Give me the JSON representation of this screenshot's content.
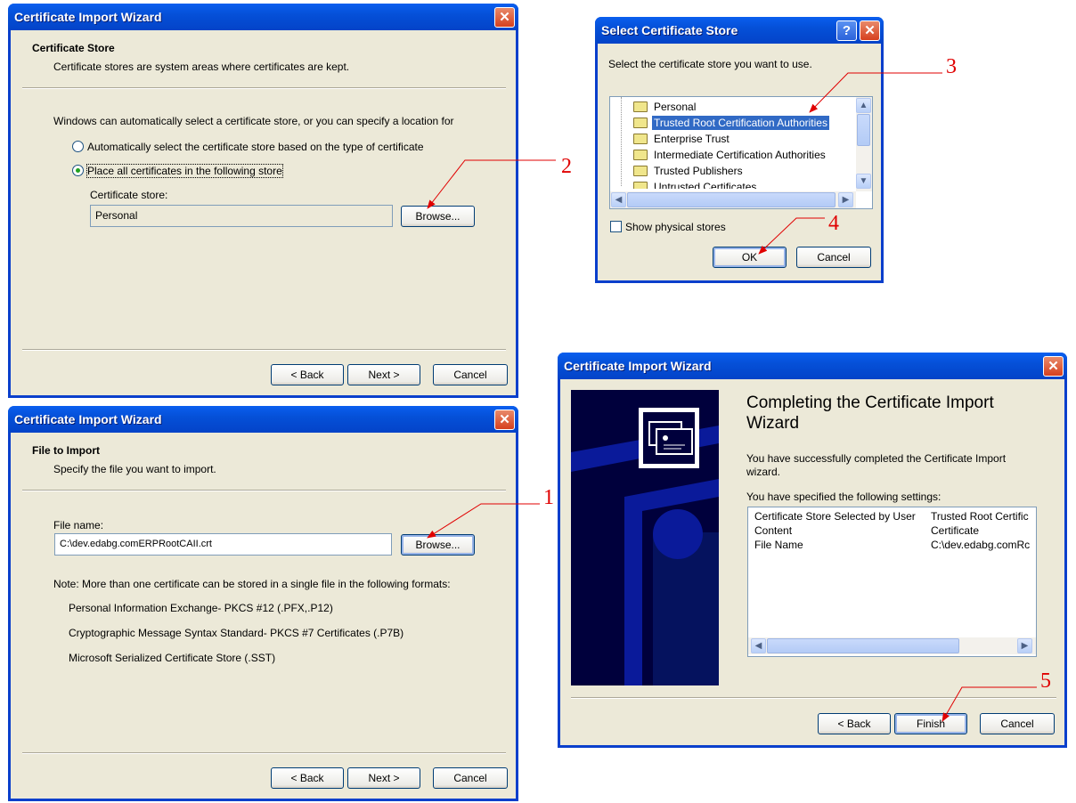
{
  "store_wizard": {
    "title": "Certificate Import Wizard",
    "heading": "Certificate Store",
    "subtitle": "Certificate stores are system areas where certificates are kept.",
    "intro": "Windows can automatically select a certificate store, or you can specify a location for",
    "radio_auto": "Automatically select the certificate store based on the type of certificate",
    "radio_place": "Place all certificates in the following store",
    "radio_selected": "place",
    "store_label": "Certificate store:",
    "store_value": "Personal",
    "browse": "Browse...",
    "back": "< Back",
    "next": "Next >",
    "cancel": "Cancel"
  },
  "file_wizard": {
    "title": "Certificate Import Wizard",
    "heading": "File to Import",
    "subtitle": "Specify the file you want to import.",
    "file_label": "File name:",
    "file_value": "C:\\dev.edabg.comERPRootCAII.crt",
    "browse": "Browse...",
    "note": "Note:  More than one certificate can be stored in a single file in the following formats:",
    "formats": [
      "Personal Information Exchange- PKCS #12 (.PFX,.P12)",
      "Cryptographic Message Syntax Standard- PKCS #7 Certificates (.P7B)",
      "Microsoft Serialized Certificate Store (.SST)"
    ],
    "back": "< Back",
    "next": "Next >",
    "cancel": "Cancel"
  },
  "select_store": {
    "title": "Select Certificate Store",
    "help": "?",
    "prompt": "Select the certificate store you want to use.",
    "stores": [
      "Personal",
      "Trusted Root Certification Authorities",
      "Enterprise Trust",
      "Intermediate Certification Authorities",
      "Trusted Publishers",
      "Untrusted Certificates"
    ],
    "selected": "Trusted Root Certification Authorities",
    "show_physical": "Show physical stores",
    "show_physical_checked": false,
    "ok": "OK",
    "cancel": "Cancel"
  },
  "complete_wizard": {
    "title": "Certificate Import Wizard",
    "heading": "Completing the Certificate Import Wizard",
    "message": "You have successfully completed the Certificate Import wizard.",
    "settings_label": "You have specified the following settings:",
    "settings": [
      {
        "name": "Certificate Store Selected by User",
        "value": "Trusted Root Certific"
      },
      {
        "name": "Content",
        "value": "Certificate"
      },
      {
        "name": "File Name",
        "value": "C:\\dev.edabg.comRc"
      }
    ],
    "back": "< Back",
    "finish": "Finish",
    "cancel": "Cancel"
  },
  "annotations": [
    "1",
    "2",
    "3",
    "4",
    "5"
  ],
  "colors": {
    "titlebar": "#0550D8",
    "dialog_bg": "#ECE9D8",
    "annotation": "#E00000",
    "selection": "#316AC5"
  }
}
